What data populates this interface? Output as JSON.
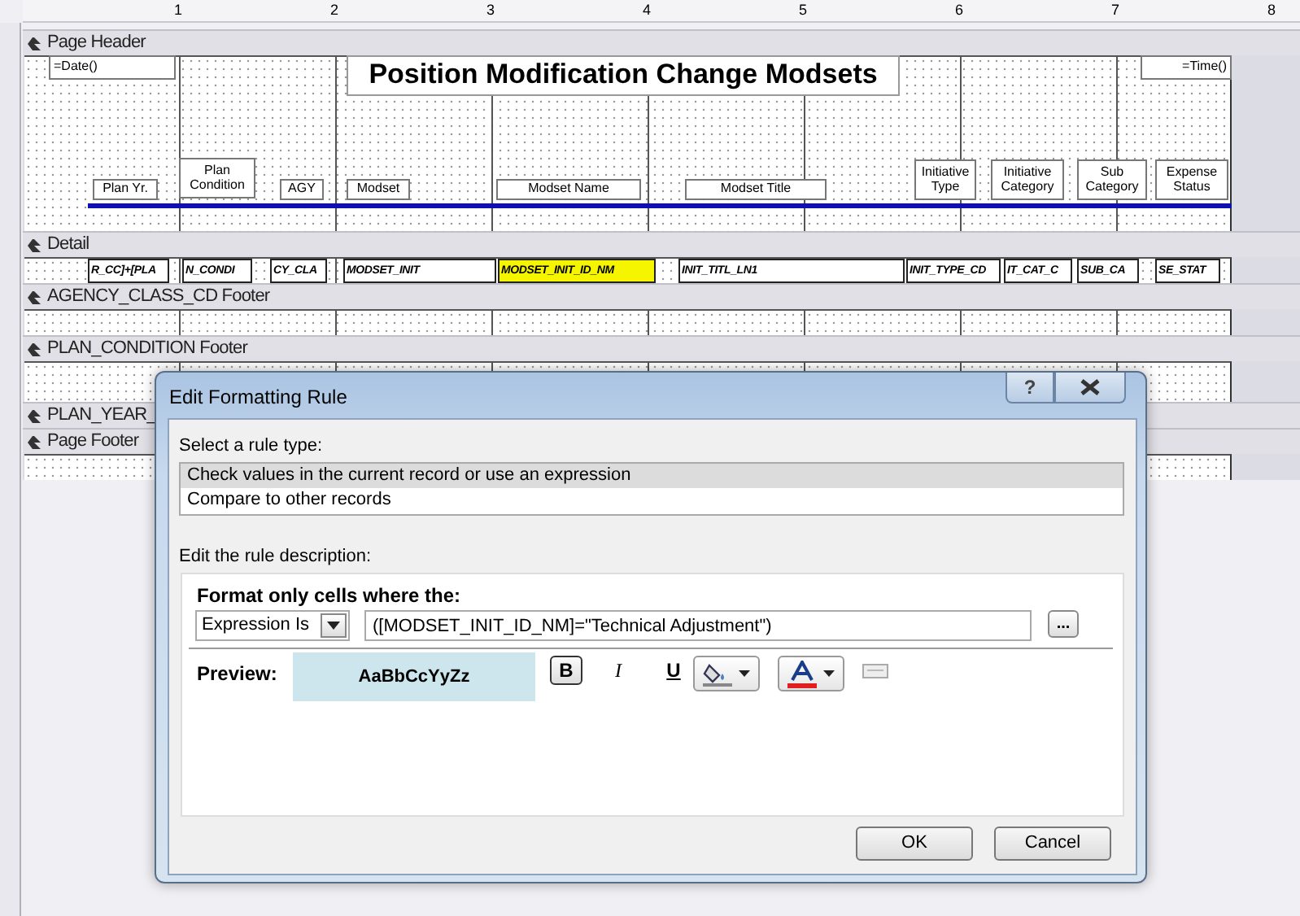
{
  "ruler": {
    "marks": [
      "1",
      "2",
      "3",
      "4",
      "5",
      "6",
      "7",
      "8"
    ]
  },
  "sections": [
    {
      "title": "Page Header",
      "controls": [
        {
          "kind": "textbox",
          "text": "=Date()",
          "highlighted": false
        },
        {
          "kind": "title",
          "text": "Position Modification Change Modsets",
          "highlighted": false
        },
        {
          "kind": "textbox",
          "text": "=Time()",
          "highlighted": false
        },
        {
          "kind": "label",
          "text": "Plan Yr.",
          "highlighted": false
        },
        {
          "kind": "label",
          "text": "Plan Condition",
          "highlighted": false
        },
        {
          "kind": "label",
          "text": "AGY",
          "highlighted": false
        },
        {
          "kind": "label",
          "text": "Modset",
          "highlighted": false
        },
        {
          "kind": "label",
          "text": "Modset Name",
          "highlighted": false
        },
        {
          "kind": "label",
          "text": "Modset Title",
          "highlighted": false
        },
        {
          "kind": "label",
          "text": "Initiative Type",
          "highlighted": false
        },
        {
          "kind": "label",
          "text": "Initiative Category",
          "highlighted": false
        },
        {
          "kind": "label",
          "text": "Sub Category",
          "highlighted": false
        },
        {
          "kind": "label",
          "text": "Expense Status",
          "highlighted": false
        }
      ]
    },
    {
      "title": "Detail",
      "controls": [
        {
          "kind": "field",
          "text": "R_CC]+[PLA",
          "highlighted": false
        },
        {
          "kind": "field",
          "text": "N_CONDI",
          "highlighted": false
        },
        {
          "kind": "field",
          "text": "CY_CLA",
          "highlighted": false
        },
        {
          "kind": "field",
          "text": "MODSET_INIT",
          "highlighted": false
        },
        {
          "kind": "field",
          "text": "MODSET_INIT_ID_NM",
          "highlighted": true
        },
        {
          "kind": "field",
          "text": "INIT_TITL_LN1",
          "highlighted": false
        },
        {
          "kind": "field",
          "text": "INIT_TYPE_CD",
          "highlighted": false
        },
        {
          "kind": "field",
          "text": "IT_CAT_C",
          "highlighted": false
        },
        {
          "kind": "field",
          "text": "SUB_CA",
          "highlighted": false
        },
        {
          "kind": "field",
          "text": "SE_STAT",
          "highlighted": false
        }
      ]
    },
    {
      "title": "AGENCY_CLASS_CD Footer"
    },
    {
      "title": "PLAN_CONDITION Footer"
    },
    {
      "title": "PLAN_YEAR_"
    },
    {
      "title": "Page Footer"
    }
  ],
  "dialog": {
    "title": "Edit Formatting Rule",
    "help": "?",
    "rule_type_label": "Select a rule type:",
    "rule_types": [
      {
        "label": "Check values in the current record or use an expression",
        "selected": true
      },
      {
        "label": "Compare to other records",
        "selected": false
      }
    ],
    "description_label": "Edit the rule description:",
    "condition_label": "Format only cells where the:",
    "condition_type": "Expression Is",
    "expression": "([MODSET_INIT_ID_NM]=\"Technical Adjustment\")",
    "builder_button": "...",
    "preview_label": "Preview:",
    "preview": {
      "text": "AaBbCcYyZz",
      "bold": true
    },
    "format_buttons": [
      {
        "kind": "bold",
        "label": "B",
        "on": true
      },
      {
        "kind": "italic",
        "label": "I",
        "on": false
      },
      {
        "kind": "underline",
        "label": "U",
        "on": false
      }
    ],
    "buttons": [
      "OK",
      "Cancel"
    ]
  }
}
